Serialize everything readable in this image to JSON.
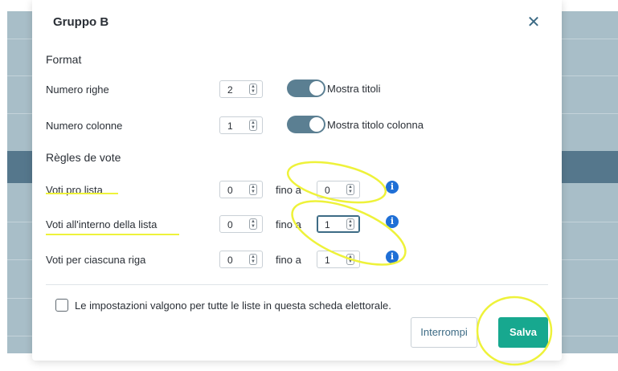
{
  "modal": {
    "title": "Gruppo B",
    "close_icon": "close-icon"
  },
  "format": {
    "heading": "Format",
    "rows": [
      {
        "label": "Numero righe",
        "value": "2",
        "toggle_label": "Mostra titoli",
        "toggle_on": true
      },
      {
        "label": "Numero colonne",
        "value": "1",
        "toggle_label": "Mostra titolo colonna",
        "toggle_on": true
      }
    ]
  },
  "rules": {
    "heading": "Règles de vote",
    "rows": [
      {
        "label": "Voti pro lista",
        "min": "0",
        "connector": "fino a",
        "max": "0",
        "info_icon": "info-icon"
      },
      {
        "label": "Voti all'interno della lista",
        "min": "0",
        "connector": "fino a",
        "max": "1",
        "info_icon": "info-icon"
      },
      {
        "label": "Voti per ciascuna riga",
        "min": "0",
        "connector": "fino a",
        "max": "1",
        "info_icon": "info-icon"
      }
    ]
  },
  "footer": {
    "checkbox_label": "Le impostazioni valgono per tutte le liste in questa scheda elettorale.",
    "checkbox_checked": false,
    "cancel_label": "Interrompi",
    "save_label": "Salva"
  },
  "colors": {
    "accent": "#3d6b85",
    "save": "#17a88f",
    "info": "#1f6fd6",
    "annotation": "#eef23a"
  }
}
